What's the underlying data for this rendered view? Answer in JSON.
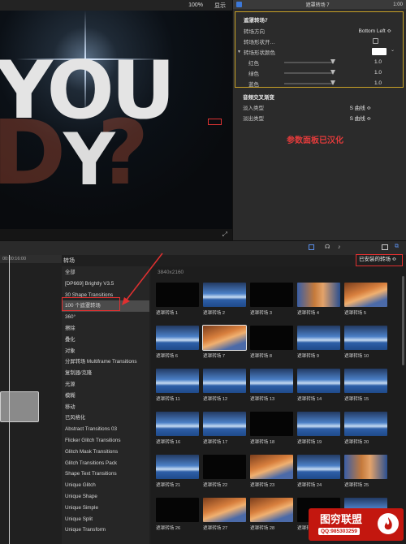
{
  "viewer": {
    "zoom": "100%",
    "display": "显示",
    "canvas_text_line1": "YOU",
    "canvas_text_line2": "Y",
    "canvas_text_blur": "D ?"
  },
  "inspector": {
    "header_title": "遮罩转场 7",
    "header_time": "1:00",
    "effect_title": "遮罩转场7",
    "rows": [
      {
        "label": "转场方向",
        "value": "Bottom Left ≎"
      },
      {
        "label": "转场形状开…",
        "value": ""
      },
      {
        "label": "转场形状颜色",
        "value": ""
      },
      {
        "label": "红色",
        "value": "1.0"
      },
      {
        "label": "绿色",
        "value": "1.0"
      },
      {
        "label": "蓝色",
        "value": "1.0"
      }
    ],
    "audio_section": "音频交叉渐变",
    "fade_in_label": "淡入类型",
    "fade_in_value": "S 曲线 ≎",
    "fade_out_label": "淡出类型",
    "fade_out_value": "S 曲线 ≎",
    "note": "参数面板已汉化"
  },
  "timeline": {
    "ruler": "00:00:16:00"
  },
  "browser": {
    "title": "转场",
    "installed": "已安装的转场 ≎",
    "resolution": "3840x2160",
    "categories": [
      "全部",
      "[DP669] Brightly V3.5",
      "30 Shape Transitions",
      "100 个遮罩转场",
      "360°",
      "擦除",
      "叠化",
      "对象",
      "分屏转场 Multiframe Transitions",
      "复制器/克隆",
      "光源",
      "模糊",
      "移动",
      "已风格化",
      "Abstract Transitions 03",
      "Flicker Glitch Transitions",
      "Glitch Mask Transitions",
      "Glitch Transitions Pack",
      "Shape Text Transitions",
      "Unique Glitch",
      "Unique Shape",
      "Unique Simple",
      "Unique Split",
      "Unique Transform"
    ],
    "tiles": [
      "遮罩转场 1",
      "遮罩转场 2",
      "遮罩转场 3",
      "遮罩转场 4",
      "遮罩转场 5",
      "遮罩转场 6",
      "遮罩转场 7",
      "遮罩转场 8",
      "遮罩转场 9",
      "遮罩转场 10",
      "遮罩转场 11",
      "遮罩转场 12",
      "遮罩转场 13",
      "遮罩转场 14",
      "遮罩转场 15",
      "遮罩转场 16",
      "遮罩转场 17",
      "遮罩转场 18",
      "遮罩转场 19",
      "遮罩转场 20",
      "遮罩转场 21",
      "遮罩转场 22",
      "遮罩转场 23",
      "遮罩转场 24",
      "遮罩转场 25",
      "遮罩转场 26",
      "遮罩转场 27",
      "遮罩转场 28",
      "遮罩转场 29",
      "遮罩转场 30"
    ]
  },
  "watermark": {
    "title": "图穷联盟",
    "sub": "QQ:985303259"
  }
}
